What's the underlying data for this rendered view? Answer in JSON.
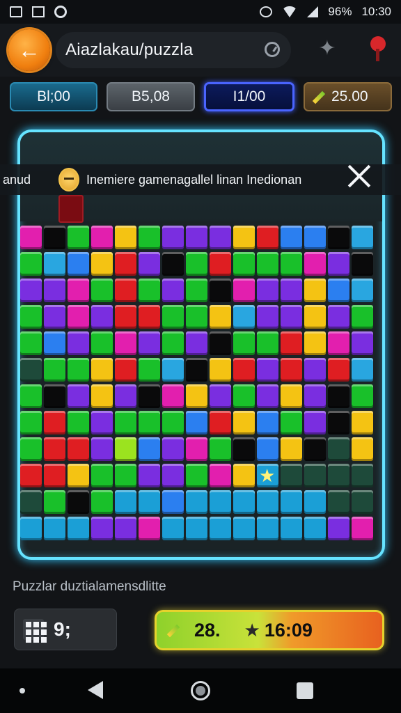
{
  "status_bar": {
    "battery": "96%",
    "time": "10:30"
  },
  "app": {
    "title": "Aiazlakau/puzzla"
  },
  "stats": [
    {
      "value": "Bl;00"
    },
    {
      "value": "B5,08"
    },
    {
      "value": "I1/00"
    },
    {
      "value": "25.00"
    }
  ],
  "notice": {
    "label": "anud",
    "text": "Inemiere gamenagallel linan Inedionan"
  },
  "board": {
    "palette": {
      "G": "#19c02a",
      "B": "#2b7ff0",
      "P": "#7a2ee0",
      "Y": "#f4c313",
      "R": "#df1e22",
      "K": "#0a0a0b",
      "M": "#e21fae",
      "C": "#29a6e0",
      "L": "#9be31f",
      "D": "#1e4a3a",
      "S": "#1b9fd6"
    },
    "rows": [
      "MKGMYGPPPYRBBKC",
      "GCBYRPKGRGGGMPK",
      "PPMGRGPGKMPPYBC",
      "GPMPRRGGYCPPYPG",
      "GBPGMPGPKGGRYMP",
      "DGGYRGCKYRPRPRC",
      "GKPYPKMYPGPYPKG",
      "GRGPGGGBRYBGPKY",
      "GRRPLBPMGKBYKDY",
      "RRYGGPPGMYSDDDD",
      "DGKGSSBSSSSSSDD",
      "SSSPPMSSSSSSSPM"
    ]
  },
  "footer": {
    "hint": "Puzzlar duztialamensdlitte",
    "moves": "9;",
    "score_a": "28.",
    "score_b": "16:09"
  }
}
